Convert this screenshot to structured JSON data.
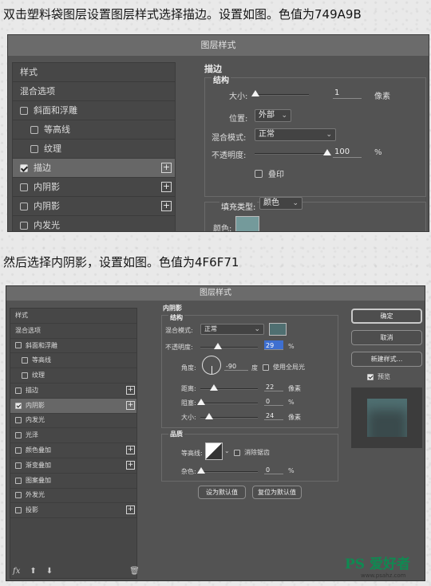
{
  "captions": {
    "top": "双击塑料袋图层设置图层样式选择描边。设置如图。色值为749A9B",
    "middle": "然后选择内阴影，设置如图。色值为4F6F71"
  },
  "dialog1": {
    "title": "图层样式",
    "list": [
      {
        "label": "样式",
        "check": false,
        "indent": false,
        "plus": false,
        "sel": false,
        "nocb": true
      },
      {
        "label": "混合选项",
        "check": false,
        "indent": false,
        "plus": false,
        "sel": false,
        "nocb": true
      },
      {
        "label": "斜面和浮雕",
        "check": false,
        "indent": false,
        "plus": false,
        "sel": false
      },
      {
        "label": "等高线",
        "check": false,
        "indent": true,
        "plus": false,
        "sel": false
      },
      {
        "label": "纹理",
        "check": false,
        "indent": true,
        "plus": false,
        "sel": false
      },
      {
        "label": "描边",
        "check": true,
        "indent": false,
        "plus": true,
        "sel": true
      },
      {
        "label": "内阴影",
        "check": false,
        "indent": false,
        "plus": true,
        "sel": false
      },
      {
        "label": "内阴影",
        "check": false,
        "indent": false,
        "plus": true,
        "sel": false
      },
      {
        "label": "内发光",
        "check": false,
        "indent": false,
        "plus": false,
        "sel": false
      }
    ],
    "stroke": {
      "section": "描边",
      "structure": "结构",
      "size_label": "大小:",
      "size_value": "1",
      "size_unit": "像素",
      "position_label": "位置:",
      "position_value": "外部",
      "blend_label": "混合模式:",
      "blend_value": "正常",
      "opacity_label": "不透明度:",
      "opacity_value": "100",
      "opacity_unit": "%",
      "overprint_label": "叠印",
      "fill_type_label": "填充类型:",
      "fill_type_value": "颜色",
      "color_label": "颜色:",
      "color": "#749A9B"
    }
  },
  "dialog2": {
    "title": "图层样式",
    "list": [
      {
        "label": "样式",
        "nocb": true
      },
      {
        "label": "混合选项",
        "nocb": true
      },
      {
        "label": "斜面和浮雕"
      },
      {
        "label": "等高线",
        "indent": true
      },
      {
        "label": "纹理",
        "indent": true
      },
      {
        "label": "描边",
        "plus": true
      },
      {
        "label": "内阴影",
        "check": true,
        "plus": true,
        "sel": true
      },
      {
        "label": "内发光"
      },
      {
        "label": "光泽"
      },
      {
        "label": "颜色叠加",
        "plus": true
      },
      {
        "label": "渐变叠加",
        "plus": true
      },
      {
        "label": "图案叠加"
      },
      {
        "label": "外发光"
      },
      {
        "label": "投影",
        "plus": true
      }
    ],
    "inner_shadow": {
      "section": "内阴影",
      "structure": "结构",
      "blend_label": "混合模式:",
      "blend_value": "正常",
      "color": "#4F6F71",
      "opacity_label": "不透明度:",
      "opacity_value": "29",
      "opacity_unit": "%",
      "angle_label": "角度:",
      "angle_value": "-90",
      "angle_unit": "度",
      "global_light_label": "使用全局光",
      "distance_label": "距离:",
      "distance_value": "22",
      "distance_unit": "像素",
      "choke_label": "阻塞:",
      "choke_value": "0",
      "choke_unit": "%",
      "size_label": "大小:",
      "size_value": "24",
      "size_unit": "像素",
      "quality": "品质",
      "contour_label": "等高线:",
      "antialias_label": "消除锯齿",
      "noise_label": "杂色:",
      "noise_value": "0",
      "noise_unit": "%",
      "set_default": "设为默认值",
      "reset_default": "复位为默认值"
    },
    "buttons": {
      "ok": "确定",
      "cancel": "取消",
      "new_style": "新建样式...",
      "preview": "预览"
    },
    "footer_icon_fx": "fx"
  },
  "watermark": {
    "brand": "PS 爱好者",
    "site": "www.psahz.com"
  }
}
